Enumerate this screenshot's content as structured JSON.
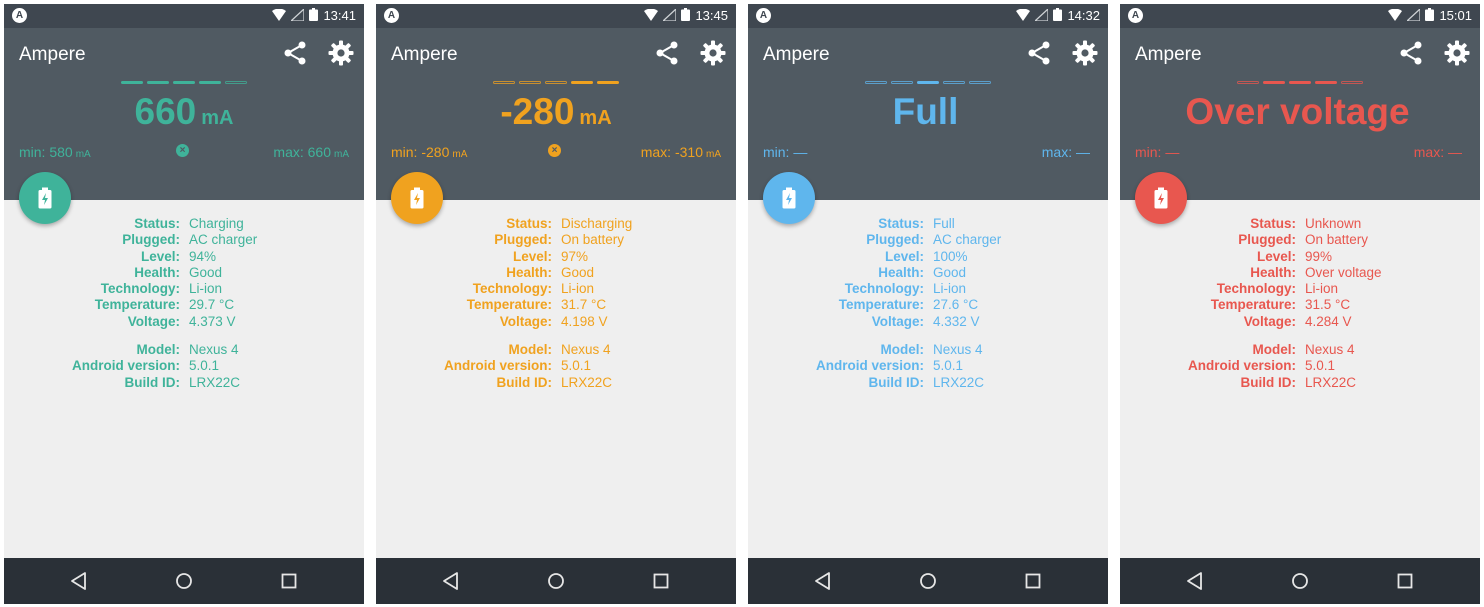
{
  "phones": [
    {
      "time": "13:41",
      "app_title": "Ampere",
      "accent": "#3fb39a",
      "level_segments": 5,
      "level_filled": [
        true,
        true,
        true,
        true,
        false
      ],
      "big_value": "660",
      "big_unit": "mA",
      "min_label": "min:",
      "min_value": "580",
      "min_unit": "mA",
      "max_label": "max:",
      "max_value": "660",
      "max_unit": "mA",
      "reset_icon": "close-circle-icon",
      "info": [
        {
          "label": "Status:",
          "value": "Charging"
        },
        {
          "label": "Plugged:",
          "value": "AC charger"
        },
        {
          "label": "Level:",
          "value": "94%"
        },
        {
          "label": "Health:",
          "value": "Good"
        },
        {
          "label": "Technology:",
          "value": "Li-ion"
        },
        {
          "label": "Temperature:",
          "value": "29.7 °C"
        },
        {
          "label": "Voltage:",
          "value": "4.373 V"
        }
      ],
      "device": [
        {
          "label": "Model:",
          "value": "Nexus 4"
        },
        {
          "label": "Android version:",
          "value": "5.0.1"
        },
        {
          "label": "Build ID:",
          "value": "LRX22C"
        }
      ]
    },
    {
      "time": "13:45",
      "app_title": "Ampere",
      "accent": "#f0a21f",
      "level_segments": 5,
      "level_filled": [
        false,
        false,
        false,
        true,
        true
      ],
      "big_value": "-280",
      "big_unit": "mA",
      "min_label": "min:",
      "min_value": "-280",
      "min_unit": "mA",
      "max_label": "max:",
      "max_value": "-310",
      "max_unit": "mA",
      "reset_icon": "close-circle-icon",
      "info": [
        {
          "label": "Status:",
          "value": "Discharging"
        },
        {
          "label": "Plugged:",
          "value": "On battery"
        },
        {
          "label": "Level:",
          "value": "97%"
        },
        {
          "label": "Health:",
          "value": "Good"
        },
        {
          "label": "Technology:",
          "value": "Li-ion"
        },
        {
          "label": "Temperature:",
          "value": "31.7 °C"
        },
        {
          "label": "Voltage:",
          "value": "4.198 V"
        }
      ],
      "device": [
        {
          "label": "Model:",
          "value": "Nexus 4"
        },
        {
          "label": "Android version:",
          "value": "5.0.1"
        },
        {
          "label": "Build ID:",
          "value": "LRX22C"
        }
      ]
    },
    {
      "time": "14:32",
      "app_title": "Ampere",
      "accent": "#5fb6ed",
      "level_segments": 5,
      "level_filled": [
        false,
        false,
        true,
        false,
        false
      ],
      "big_value": "Full",
      "big_unit": "",
      "min_label": "min:",
      "min_value": "—",
      "min_unit": "",
      "max_label": "max:",
      "max_value": "—",
      "max_unit": "",
      "reset_icon": "",
      "info": [
        {
          "label": "Status:",
          "value": "Full"
        },
        {
          "label": "Plugged:",
          "value": "AC charger"
        },
        {
          "label": "Level:",
          "value": "100%"
        },
        {
          "label": "Health:",
          "value": "Good"
        },
        {
          "label": "Technology:",
          "value": "Li-ion"
        },
        {
          "label": "Temperature:",
          "value": "27.6 °C"
        },
        {
          "label": "Voltage:",
          "value": "4.332 V"
        }
      ],
      "device": [
        {
          "label": "Model:",
          "value": "Nexus 4"
        },
        {
          "label": "Android version:",
          "value": "5.0.1"
        },
        {
          "label": "Build ID:",
          "value": "LRX22C"
        }
      ]
    },
    {
      "time": "15:01",
      "app_title": "Ampere",
      "accent": "#e8574f",
      "level_segments": 5,
      "level_filled": [
        false,
        true,
        true,
        true,
        false
      ],
      "big_value": "Over voltage",
      "big_unit": "",
      "min_label": "min:",
      "min_value": "—",
      "min_unit": "",
      "max_label": "max:",
      "max_value": "—",
      "max_unit": "",
      "reset_icon": "",
      "info": [
        {
          "label": "Status:",
          "value": "Unknown"
        },
        {
          "label": "Plugged:",
          "value": "On battery"
        },
        {
          "label": "Level:",
          "value": "99%"
        },
        {
          "label": "Health:",
          "value": "Over voltage"
        },
        {
          "label": "Technology:",
          "value": "Li-ion"
        },
        {
          "label": "Temperature:",
          "value": "31.5 °C"
        },
        {
          "label": "Voltage:",
          "value": "4.284 V"
        }
      ],
      "device": [
        {
          "label": "Model:",
          "value": "Nexus 4"
        },
        {
          "label": "Android version:",
          "value": "5.0.1"
        },
        {
          "label": "Build ID:",
          "value": "LRX22C"
        }
      ]
    }
  ],
  "colors": {
    "status_bar": "#3f4750",
    "toolbar": "#505a62",
    "content_bg": "#efefef",
    "nav_bar": "#2a3037"
  },
  "nav": [
    "back-icon",
    "home-icon",
    "recents-icon"
  ]
}
